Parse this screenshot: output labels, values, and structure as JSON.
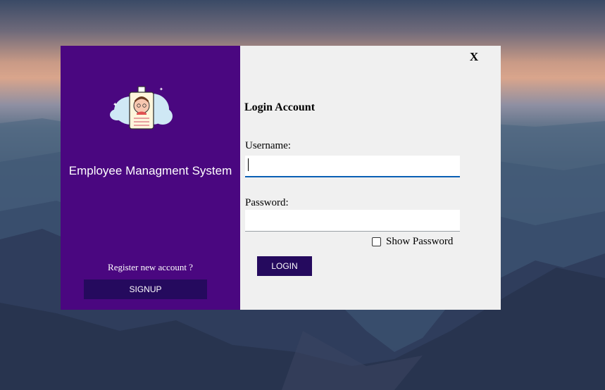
{
  "sidebar": {
    "app_title": "Employee Managment System",
    "register_prompt": "Register new account ?",
    "signup_label": "SIGNUP",
    "logo_icon": "employee-id-card-icon"
  },
  "login": {
    "close_label": "X",
    "title": "Login Account",
    "username_label": "Username:",
    "username_value": "",
    "password_label": "Password:",
    "password_value": "",
    "show_password_label": "Show Password",
    "show_password_checked": false,
    "login_label": "LOGIN"
  },
  "colors": {
    "sidebar_bg": "#4a0780",
    "button_bg": "#250a5e",
    "form_bg": "#f0f0f0",
    "focus_underline": "#0a5fb4"
  }
}
